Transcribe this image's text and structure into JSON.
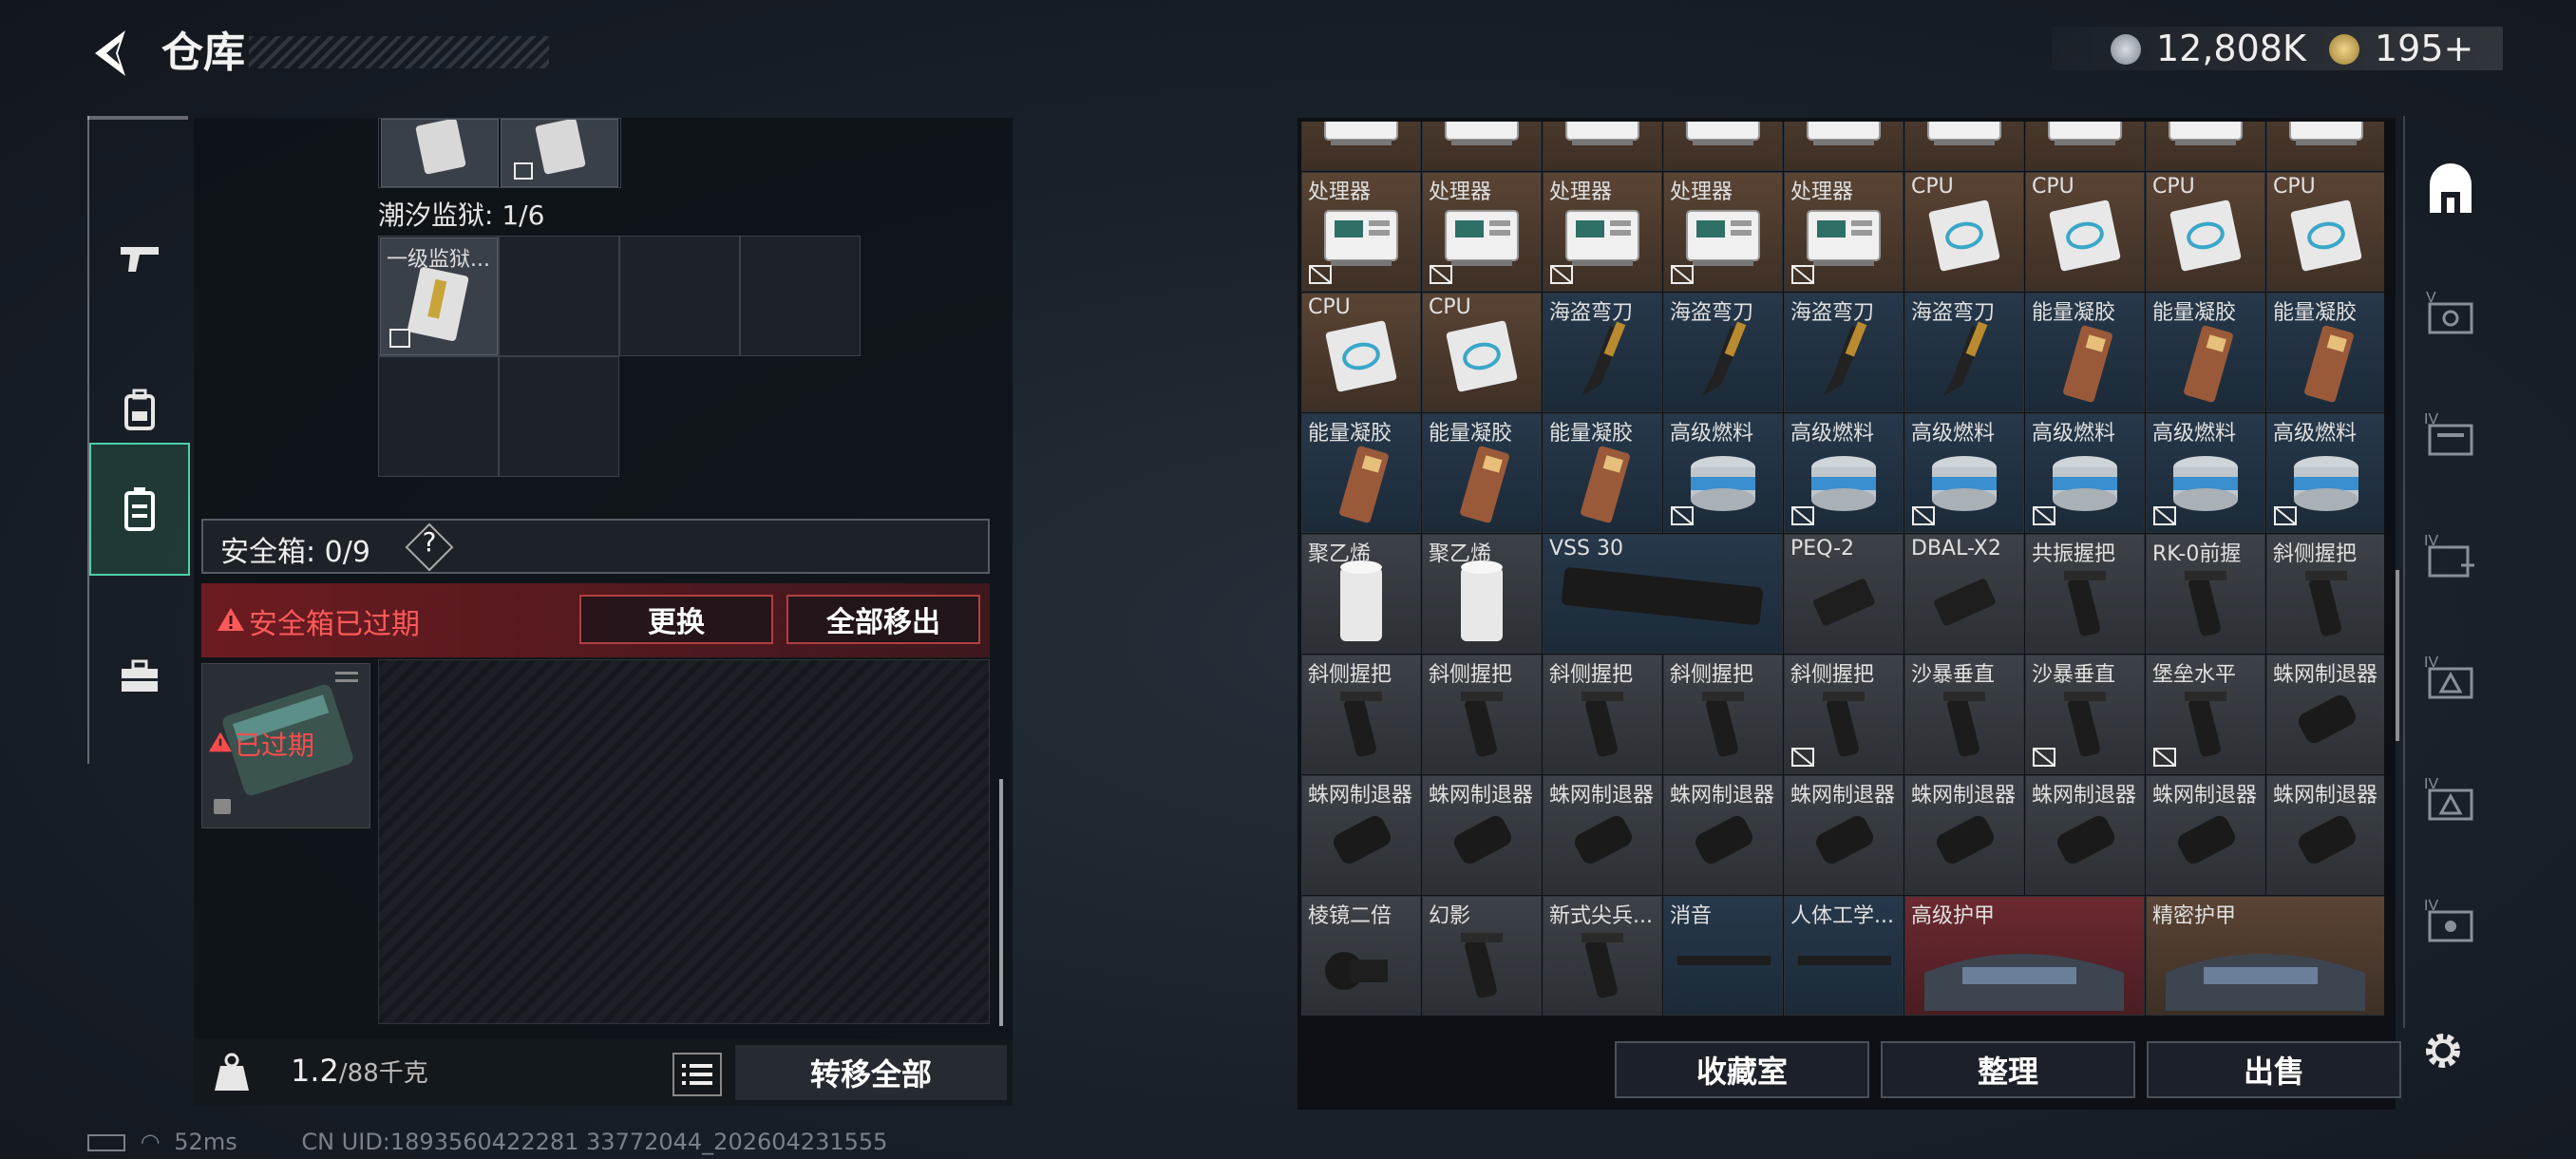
{
  "header": {
    "title": "仓库"
  },
  "currency": [
    {
      "icon": "silver-coin-icon",
      "value": "12,808K"
    },
    {
      "icon": "gold-coin-icon",
      "value": "195+"
    }
  ],
  "side_nav": [
    {
      "icon": "gun-icon"
    },
    {
      "icon": "backpack-icon"
    },
    {
      "icon": "safe-case-icon",
      "active": true
    },
    {
      "icon": "toolbox-icon"
    }
  ],
  "left": {
    "prison_label": "潮汐监狱: 1/6",
    "prison_item": "一级监狱...",
    "safe_label": "安全箱: 0/9",
    "help": "?",
    "warning": "安全箱已过期",
    "replace_btn": "更换",
    "remove_all_btn": "全部移出",
    "case_status": "已过期",
    "weight_current": "1.2",
    "weight_max": "/88千克",
    "transfer_all": "转移全部"
  },
  "inventory": {
    "rows": [
      [
        {
          "name": "",
          "icon": "processor",
          "bg": "brown"
        },
        {
          "name": "",
          "icon": "processor",
          "bg": "brown"
        },
        {
          "name": "",
          "icon": "processor",
          "bg": "brown"
        },
        {
          "name": "",
          "icon": "processor",
          "bg": "brown"
        },
        {
          "name": "",
          "icon": "processor",
          "bg": "brown"
        },
        {
          "name": "",
          "icon": "processor",
          "bg": "brown"
        },
        {
          "name": "",
          "icon": "processor",
          "bg": "brown"
        },
        {
          "name": "",
          "icon": "processor",
          "bg": "brown"
        },
        {
          "name": "",
          "icon": "processor",
          "bg": "brown"
        }
      ],
      [
        {
          "name": "处理器",
          "icon": "processor",
          "bg": "brown",
          "mark": true
        },
        {
          "name": "处理器",
          "icon": "processor",
          "bg": "brown",
          "mark": true
        },
        {
          "name": "处理器",
          "icon": "processor",
          "bg": "brown",
          "mark": true
        },
        {
          "name": "处理器",
          "icon": "processor",
          "bg": "brown",
          "mark": true
        },
        {
          "name": "处理器",
          "icon": "processor",
          "bg": "brown",
          "mark": true
        },
        {
          "name": "CPU",
          "icon": "cpu",
          "bg": "brown"
        },
        {
          "name": "CPU",
          "icon": "cpu",
          "bg": "brown"
        },
        {
          "name": "CPU",
          "icon": "cpu",
          "bg": "brown"
        },
        {
          "name": "CPU",
          "icon": "cpu",
          "bg": "brown"
        }
      ],
      [
        {
          "name": "CPU",
          "icon": "cpu",
          "bg": "brown"
        },
        {
          "name": "CPU",
          "icon": "cpu",
          "bg": "brown"
        },
        {
          "name": "海盗弯刀",
          "icon": "knife",
          "bg": "blue"
        },
        {
          "name": "海盗弯刀",
          "icon": "knife",
          "bg": "blue"
        },
        {
          "name": "海盗弯刀",
          "icon": "knife",
          "bg": "blue"
        },
        {
          "name": "海盗弯刀",
          "icon": "knife",
          "bg": "blue"
        },
        {
          "name": "能量凝胶",
          "icon": "gel",
          "bg": "blue"
        },
        {
          "name": "能量凝胶",
          "icon": "gel",
          "bg": "blue"
        },
        {
          "name": "能量凝胶",
          "icon": "gel",
          "bg": "blue"
        }
      ],
      [
        {
          "name": "能量凝胶",
          "icon": "gel",
          "bg": "blue"
        },
        {
          "name": "能量凝胶",
          "icon": "gel",
          "bg": "blue"
        },
        {
          "name": "能量凝胶",
          "icon": "gel",
          "bg": "blue"
        },
        {
          "name": "高级燃料",
          "icon": "fuel",
          "bg": "blue",
          "mark": true
        },
        {
          "name": "高级燃料",
          "icon": "fuel",
          "bg": "blue",
          "mark": true
        },
        {
          "name": "高级燃料",
          "icon": "fuel",
          "bg": "blue",
          "mark": true
        },
        {
          "name": "高级燃料",
          "icon": "fuel",
          "bg": "blue",
          "mark": true
        },
        {
          "name": "高级燃料",
          "icon": "fuel",
          "bg": "blue",
          "mark": true
        },
        {
          "name": "高级燃料",
          "icon": "fuel",
          "bg": "blue",
          "mark": true
        }
      ],
      [
        {
          "name": "聚乙烯",
          "icon": "roll",
          "bg": "gray"
        },
        {
          "name": "聚乙烯",
          "icon": "roll",
          "bg": "gray"
        },
        {
          "name": "VSS 30",
          "icon": "mag",
          "bg": "blue",
          "wide": true
        },
        {
          "name": "PEQ-2",
          "icon": "laser",
          "bg": "gray"
        },
        {
          "name": "DBAL-X2",
          "icon": "laser",
          "bg": "gray"
        },
        {
          "name": "共振握把",
          "icon": "grip",
          "bg": "gray"
        },
        {
          "name": "RK-0前握",
          "icon": "grip",
          "bg": "gray"
        },
        {
          "name": "斜侧握把",
          "icon": "grip",
          "bg": "gray"
        }
      ],
      [
        {
          "name": "斜侧握把",
          "icon": "grip",
          "bg": "gray"
        },
        {
          "name": "斜侧握把",
          "icon": "grip",
          "bg": "gray"
        },
        {
          "name": "斜侧握把",
          "icon": "grip",
          "bg": "gray"
        },
        {
          "name": "斜侧握把",
          "icon": "grip",
          "bg": "gray"
        },
        {
          "name": "斜侧握把",
          "icon": "grip",
          "bg": "gray",
          "mark": true
        },
        {
          "name": "沙暴垂直",
          "icon": "grip",
          "bg": "gray"
        },
        {
          "name": "沙暴垂直",
          "icon": "grip",
          "bg": "gray",
          "mark": true
        },
        {
          "name": "堡垒水平",
          "icon": "grip",
          "bg": "gray",
          "mark": true
        },
        {
          "name": "蛛网制退器",
          "icon": "brake",
          "bg": "gray"
        }
      ],
      [
        {
          "name": "蛛网制退器",
          "icon": "brake",
          "bg": "gray"
        },
        {
          "name": "蛛网制退器",
          "icon": "brake",
          "bg": "gray"
        },
        {
          "name": "蛛网制退器",
          "icon": "brake",
          "bg": "gray"
        },
        {
          "name": "蛛网制退器",
          "icon": "brake",
          "bg": "gray"
        },
        {
          "name": "蛛网制退器",
          "icon": "brake",
          "bg": "gray"
        },
        {
          "name": "蛛网制退器",
          "icon": "brake",
          "bg": "gray"
        },
        {
          "name": "蛛网制退器",
          "icon": "brake",
          "bg": "gray"
        },
        {
          "name": "蛛网制退器",
          "icon": "brake",
          "bg": "gray"
        },
        {
          "name": "蛛网制退器",
          "icon": "brake",
          "bg": "gray"
        }
      ],
      [
        {
          "name": "棱镜二倍",
          "icon": "scope",
          "bg": "gray"
        },
        {
          "name": "幻影",
          "icon": "grip",
          "bg": "gray"
        },
        {
          "name": "新式尖兵...",
          "icon": "grip",
          "bg": "gray"
        },
        {
          "name": "消音",
          "icon": "rail",
          "bg": "blue"
        },
        {
          "name": "人体工学...",
          "icon": "rail",
          "bg": "blue"
        },
        {
          "name": "高级护甲",
          "icon": "armor",
          "bg": "red",
          "wide": true
        },
        {
          "name": "精密护甲",
          "icon": "armor",
          "bg": "brown",
          "wide": true
        }
      ]
    ]
  },
  "bottom_buttons": [
    "收藏室",
    "整理",
    "出售"
  ],
  "right_nav": [
    {
      "icon": "storage-room-icon"
    },
    {
      "icon": "vault-v-icon"
    },
    {
      "icon": "vault-iv-icon"
    },
    {
      "icon": "vault-iv-plus-icon"
    },
    {
      "icon": "vault-iv-warning-icon"
    },
    {
      "icon": "vault-iv-warning-icon"
    },
    {
      "icon": "vault-iv-tools-icon"
    }
  ],
  "status": {
    "latency": "52ms",
    "uid": "CN UID:1893560422281 33772044_202604231555"
  }
}
